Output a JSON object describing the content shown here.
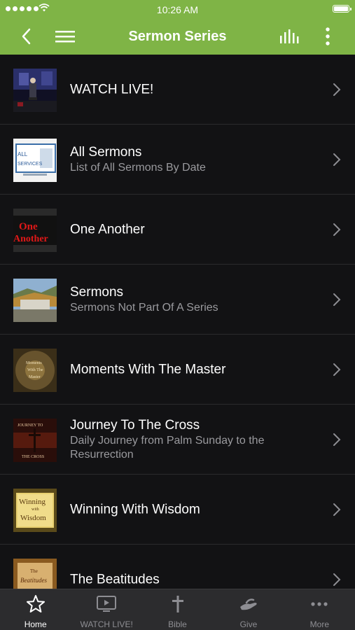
{
  "status_bar": {
    "time": "10:26 AM"
  },
  "nav": {
    "title": "Sermon Series"
  },
  "items": [
    {
      "title": "WATCH LIVE!",
      "subtitle": ""
    },
    {
      "title": "All Sermons",
      "subtitle": "List of All Sermons By Date",
      "thumb_text": [
        "ALL",
        "SERVICES"
      ]
    },
    {
      "title": "One Another",
      "subtitle": "",
      "thumb_text": [
        "One",
        "Another"
      ]
    },
    {
      "title": "Sermons",
      "subtitle": "Sermons Not Part Of A Series"
    },
    {
      "title": "Moments With The Master",
      "subtitle": "",
      "thumb_text": [
        "Moments",
        "With The",
        "Master"
      ]
    },
    {
      "title": "Journey To The Cross",
      "subtitle": "Daily Journey from Palm Sunday to the Resurrection",
      "thumb_text": [
        "JOURNEY TO",
        "THE CROSS"
      ]
    },
    {
      "title": "Winning With Wisdom",
      "subtitle": "",
      "thumb_text": [
        "Winning",
        "with",
        "Wisdom"
      ]
    },
    {
      "title": "The Beatitudes",
      "subtitle": "",
      "thumb_text": [
        "The",
        "Beatitudes"
      ]
    }
  ],
  "tabs": [
    {
      "label": "Home",
      "icon": "star-icon",
      "active": true
    },
    {
      "label": "WATCH LIVE!",
      "icon": "tv-play-icon"
    },
    {
      "label": "Bible",
      "icon": "cross-icon"
    },
    {
      "label": "Give",
      "icon": "give-hand-icon"
    },
    {
      "label": "More",
      "icon": "more-dots-icon"
    }
  ],
  "colors": {
    "header": "#7fb446",
    "background": "#121214",
    "tabbar": "#2c2c2e",
    "subtitle": "#9a9a9e"
  }
}
